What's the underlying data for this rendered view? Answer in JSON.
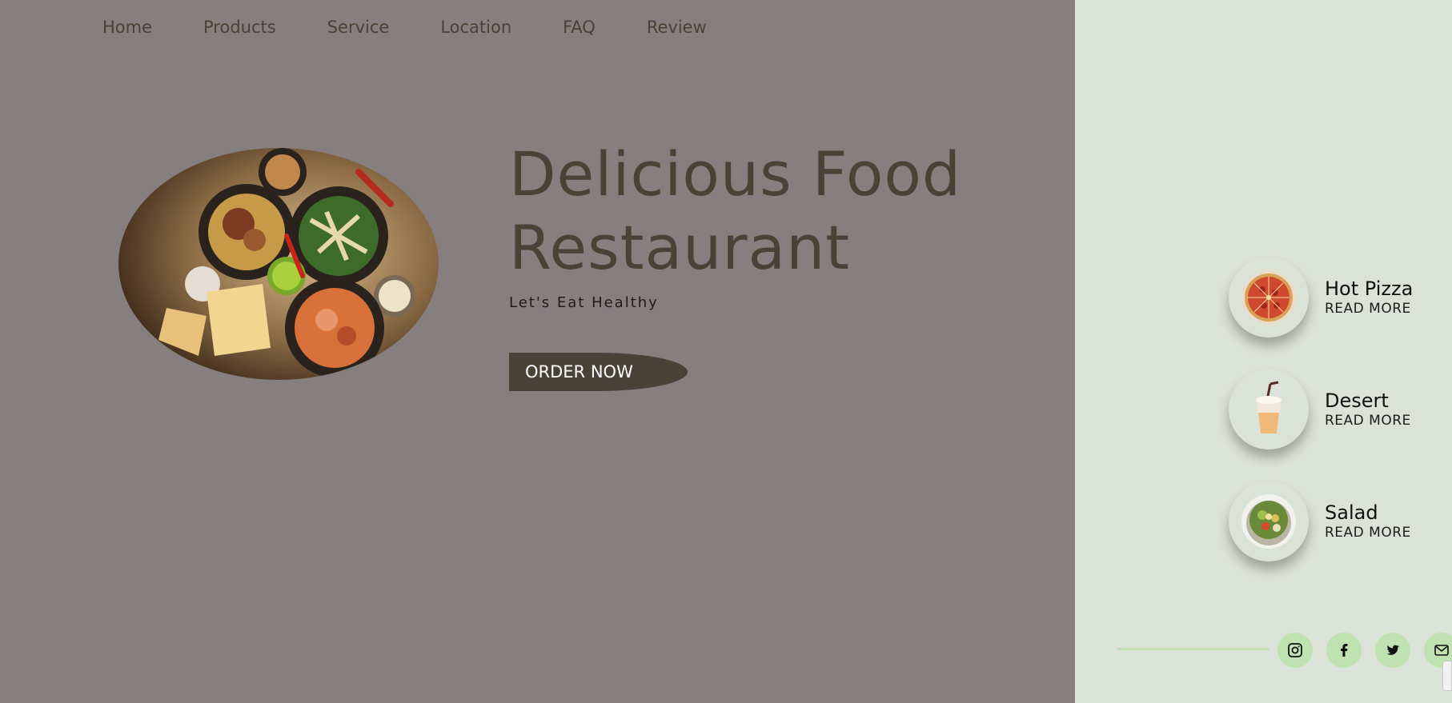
{
  "nav": {
    "items": [
      "Home",
      "Products",
      "Service",
      "Location",
      "FAQ",
      "Review"
    ]
  },
  "hero": {
    "title_line1": "Delicious Food",
    "title_line2": "Restaurant",
    "tagline": "Let's Eat Healthy",
    "cta": "ORDER NOW",
    "image_subject": "food-platter-image"
  },
  "menu": [
    {
      "title": "Hot Pizza",
      "link": "READ MORE",
      "icon": "pizza-icon"
    },
    {
      "title": "Desert",
      "link": "READ MORE",
      "icon": "milkshake-icon"
    },
    {
      "title": "Salad",
      "link": "READ MORE",
      "icon": "salad-icon"
    }
  ],
  "social": [
    "instagram-icon",
    "facebook-icon",
    "twitter-icon",
    "mail-icon"
  ],
  "colors": {
    "left_bg": "#877e80",
    "right_bg": "#dbe2d8",
    "accent_dark": "#4a4236",
    "accent_green": "#bfe2b0"
  }
}
